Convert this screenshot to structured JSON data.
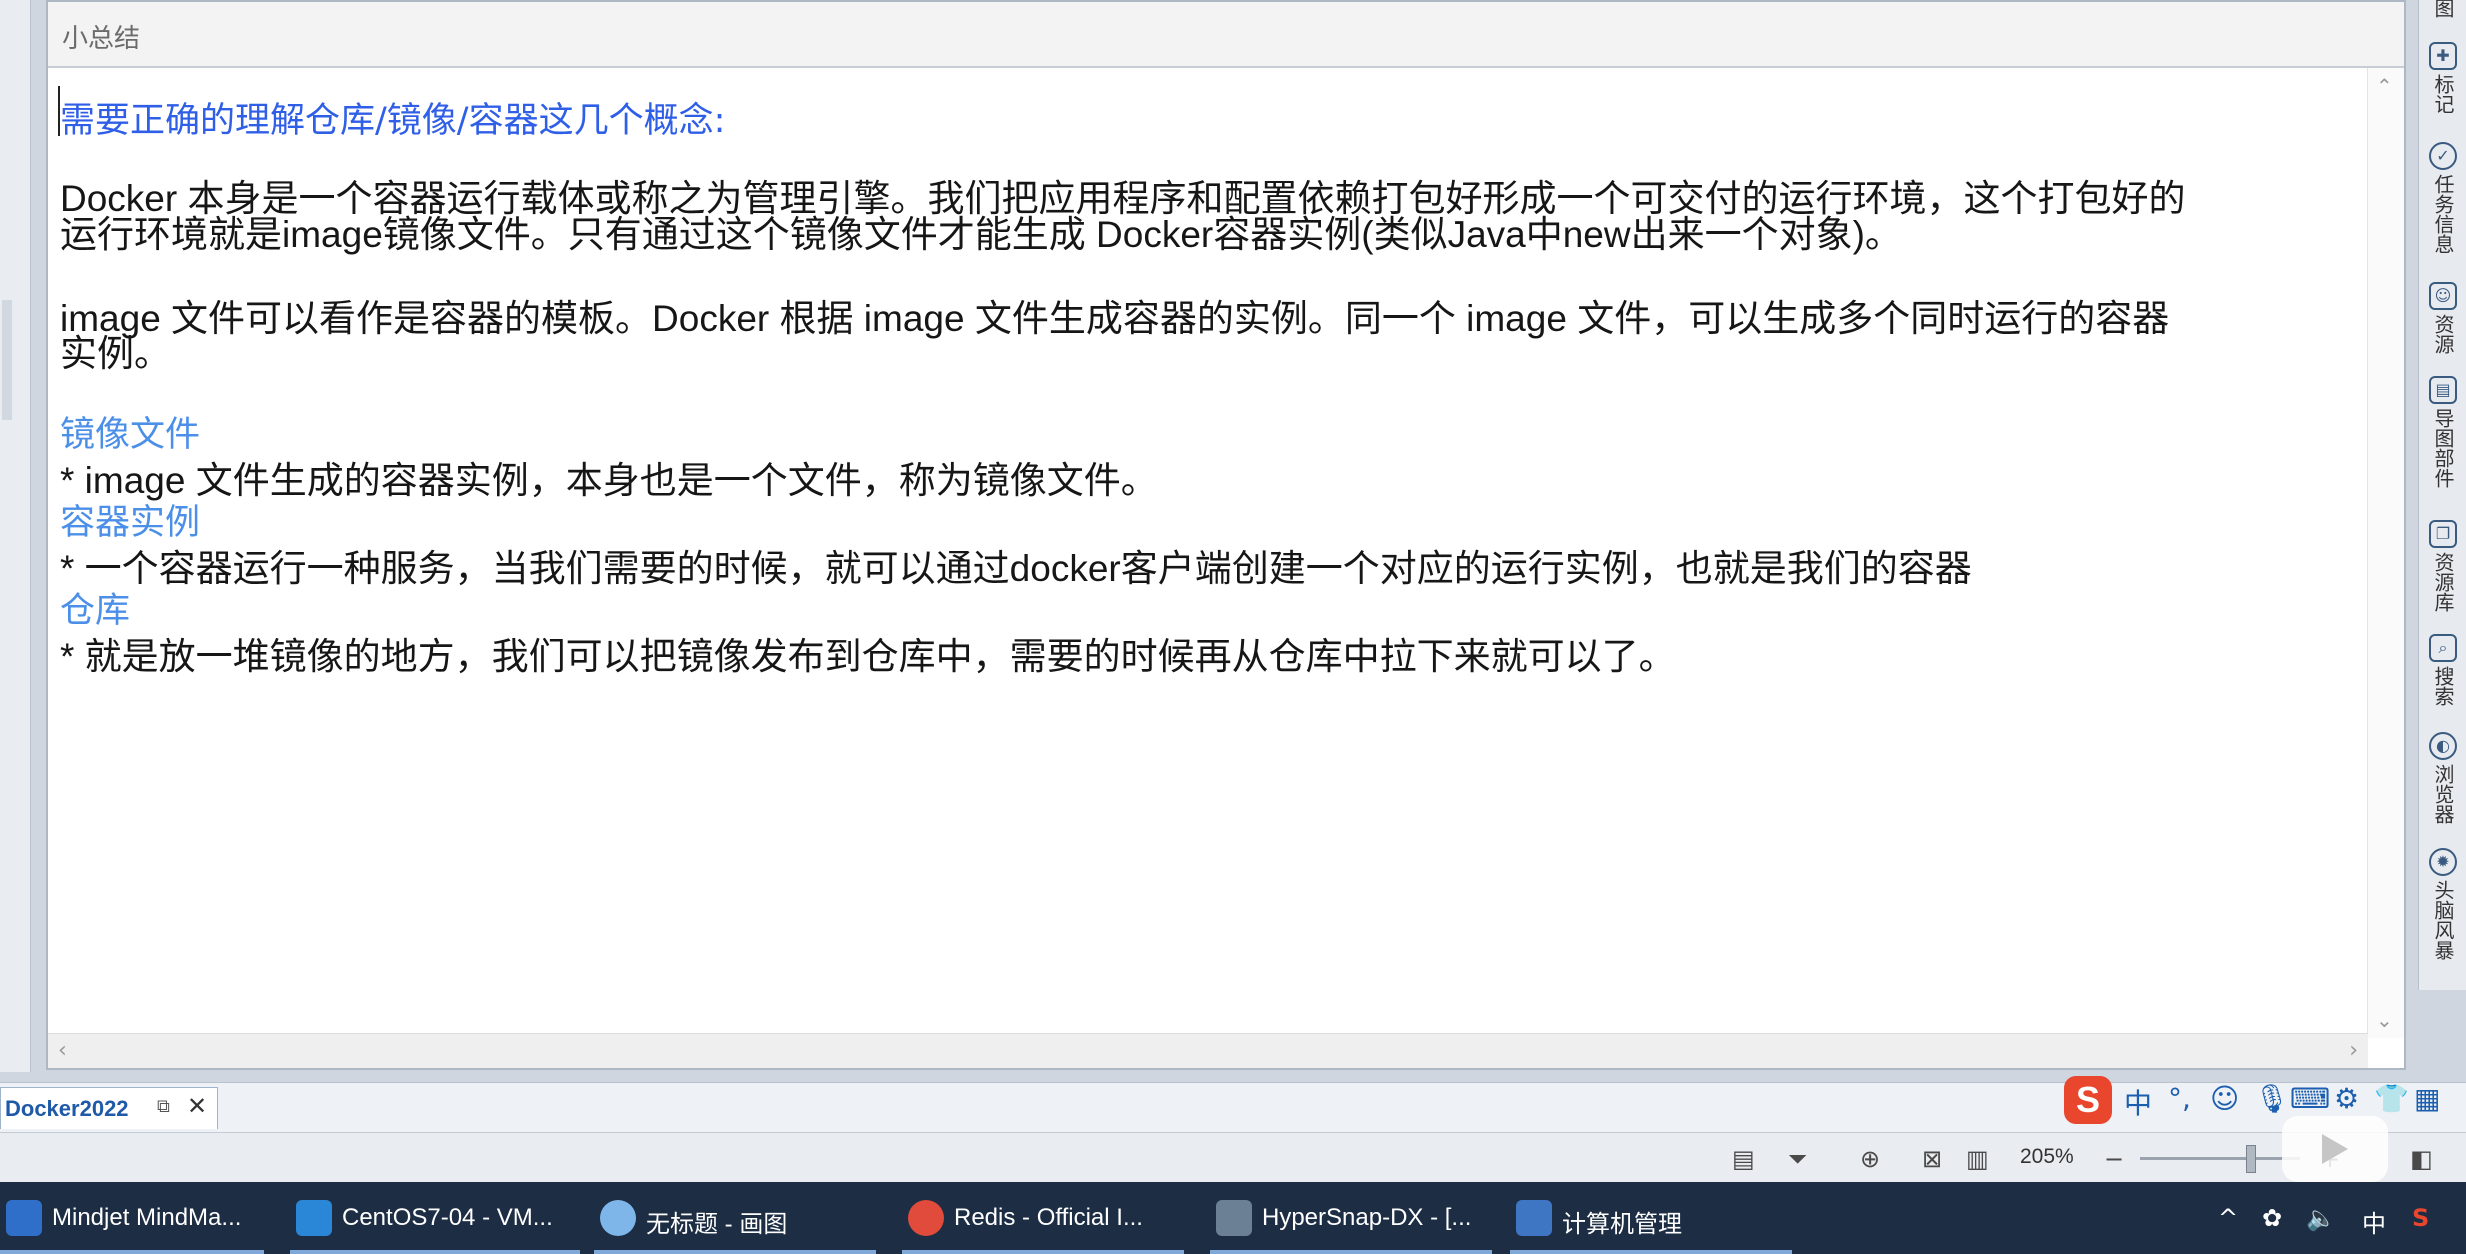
{
  "window": {
    "title": "小总结"
  },
  "notes": {
    "heading": "需要正确的理解仓库/镜像/容器这几个概念:",
    "para1_line1": "Docker 本身是一个容器运行载体或称之为管理引擎。我们把应用程序和配置依赖打包好形成一个可交付的运行环境，这个打包好的",
    "para1_line2": "运行环境就是image镜像文件。只有通过这个镜像文件才能生成 Docker容器实例(类似Java中new出来一个对象)。",
    "para2_line1": "image 文件可以看作是容器的模板。Docker 根据 image 文件生成容器的实例。同一个 image 文件，可以生成多个同时运行的容器",
    "para2_line2": "实例。",
    "section1_title": "镜像文件",
    "section1_item": "*  image 文件生成的容器实例，本身也是一个文件，称为镜像文件。",
    "section2_title": "容器实例",
    "section2_item": "*  一个容器运行一种服务，当我们需要的时候，就可以通过docker客户端创建一个对应的运行实例，也就是我们的容器",
    "section3_title": "仓库",
    "section3_item": "* 就是放一堆镜像的地方，我们可以把镜像发布到仓库中，需要的时候再从仓库中拉下来就可以了。"
  },
  "right_panel": [
    {
      "icon": "map-icon",
      "label": "图"
    },
    {
      "icon": "marker-icon",
      "label": "标记"
    },
    {
      "icon": "task-info-icon",
      "label": "任务信息"
    },
    {
      "icon": "resource-icon",
      "label": "资源"
    },
    {
      "icon": "map-parts-icon",
      "label": "导图部件"
    },
    {
      "icon": "library-icon",
      "label": "资源库"
    },
    {
      "icon": "search-icon",
      "label": "搜索"
    },
    {
      "icon": "browser-icon",
      "label": "浏览器"
    },
    {
      "icon": "brainstorm-icon",
      "label": "头脑风暴"
    }
  ],
  "doc_tab": {
    "label": "Docker2022",
    "float_glyph": "⧉",
    "close_glyph": "✕"
  },
  "ime": {
    "logo": "S",
    "mode": "中",
    "punct": "°,"
  },
  "status": {
    "zoom": "205%"
  },
  "taskbar": [
    {
      "label": "Mindjet MindMa...",
      "color": "#2f6fc9"
    },
    {
      "label": "CentOS7-04 - VM...",
      "color": "#2a86d6"
    },
    {
      "label": "无标题 - 画图",
      "color": "#7fb6e9"
    },
    {
      "label": "Redis - Official I...",
      "color": "#e14b3b"
    },
    {
      "label": "HyperSnap-DX - [...",
      "color": "#6b7f95"
    },
    {
      "label": "计算机管理",
      "color": "#3f76c4"
    }
  ],
  "tray": {
    "chevron": "^",
    "volume": "🔈",
    "lang": "中",
    "ime": "S"
  },
  "colors": {
    "heading_blue": "#2f5fe6",
    "section_blue": "#4b8fe8",
    "taskbar": "#1c2d44"
  }
}
